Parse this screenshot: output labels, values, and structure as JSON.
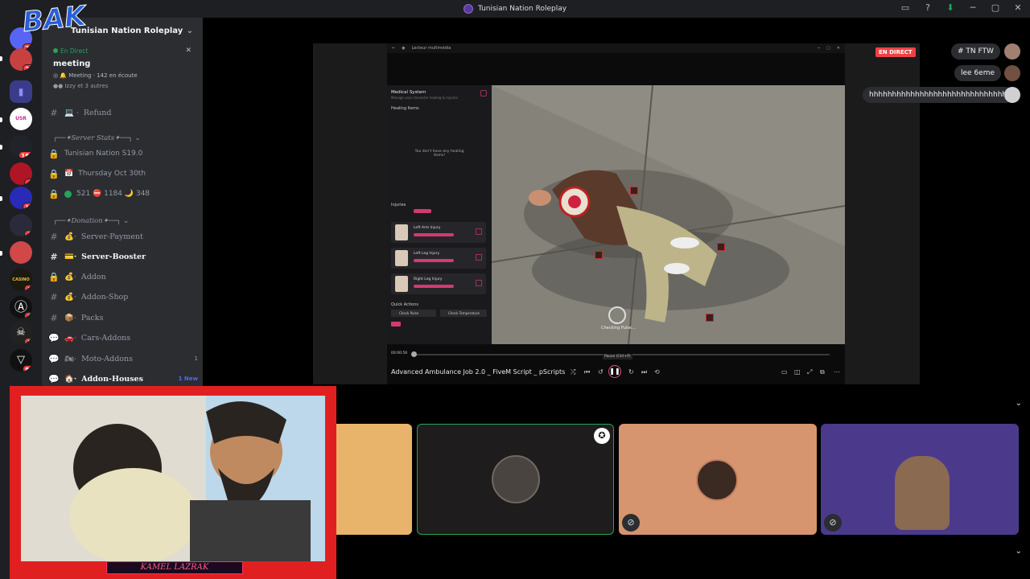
{
  "window": {
    "title": "Tunisian Nation Roleplay"
  },
  "rail": {
    "overlay_text": "BAK",
    "badges": [
      "20",
      "20",
      "184",
      "4",
      "16",
      "1",
      "3",
      "3",
      "7",
      "84"
    ],
    "server_labels": [
      "USR",
      "CASINO"
    ]
  },
  "server": {
    "name": "Tunisian Nation Roleplay"
  },
  "voice": {
    "live_label": "En Direct",
    "channel_name": "meeting",
    "activity": "Meeting · 142 en écoute",
    "participants": "Izzy et 3 autres"
  },
  "channels": [
    {
      "name": "Refund",
      "icon": "hash"
    },
    {
      "name": "Tunisian Nation S19.0",
      "icon": "lock"
    },
    {
      "name": "Thursday Oct 30th",
      "icon": "lock"
    },
    {
      "name": "521 ⛔ 1184 🌙 348",
      "icon": "lock"
    },
    {
      "name": "Server-Payment",
      "icon": "hash"
    },
    {
      "name": "Server-Booster",
      "icon": "hash"
    },
    {
      "name": "Addon",
      "icon": "lock"
    },
    {
      "name": "Addon-Shop",
      "icon": "hash"
    },
    {
      "name": "Packs",
      "icon": "hash"
    },
    {
      "name": "Cars-Addons",
      "icon": "forum"
    },
    {
      "name": "Moto-Addons",
      "icon": "forum",
      "count": "1"
    },
    {
      "name": "Addon-Houses",
      "icon": "forum",
      "new": "1 New"
    }
  ],
  "categories": {
    "stats": "Server Stats",
    "donation": "Donation"
  },
  "stream": {
    "live_badge": "EN DIRECT",
    "player_title": "Lecteur multimédia",
    "video_title": "Advanced Ambulance Job 2.0 _ FiveM Script _ pScripts",
    "time": "00:00:56",
    "tooltip": "Pause (Ctrl+P)",
    "hud": {
      "system": "Medical System",
      "subtitle": "Manage your character healing & injuries",
      "healing": "Healing Items",
      "empty": "You don't have any healing items!",
      "injuries": "Injuries",
      "injury_list": [
        "Left Arm Injury",
        "Left Leg Injury",
        "Right Leg Injury"
      ],
      "quick_actions": "Quick Actions",
      "check_pulse": "Check Pulse",
      "check_temp": "Check Temperature",
      "checking": "Checking Pulse..."
    }
  },
  "chat": [
    {
      "text": "# TN FTW"
    },
    {
      "text": "lee 6eme"
    },
    {
      "text": "hhhhhhhhhhhhhhhhhhhhhhhhhhhhhh"
    }
  ],
  "webcam": {
    "banner": "KAMEL LAZRAK"
  },
  "colors": {
    "accent": "#5865f2",
    "live": "#ed4245",
    "online": "#23a55a",
    "webcam_frame": "#e02020"
  }
}
